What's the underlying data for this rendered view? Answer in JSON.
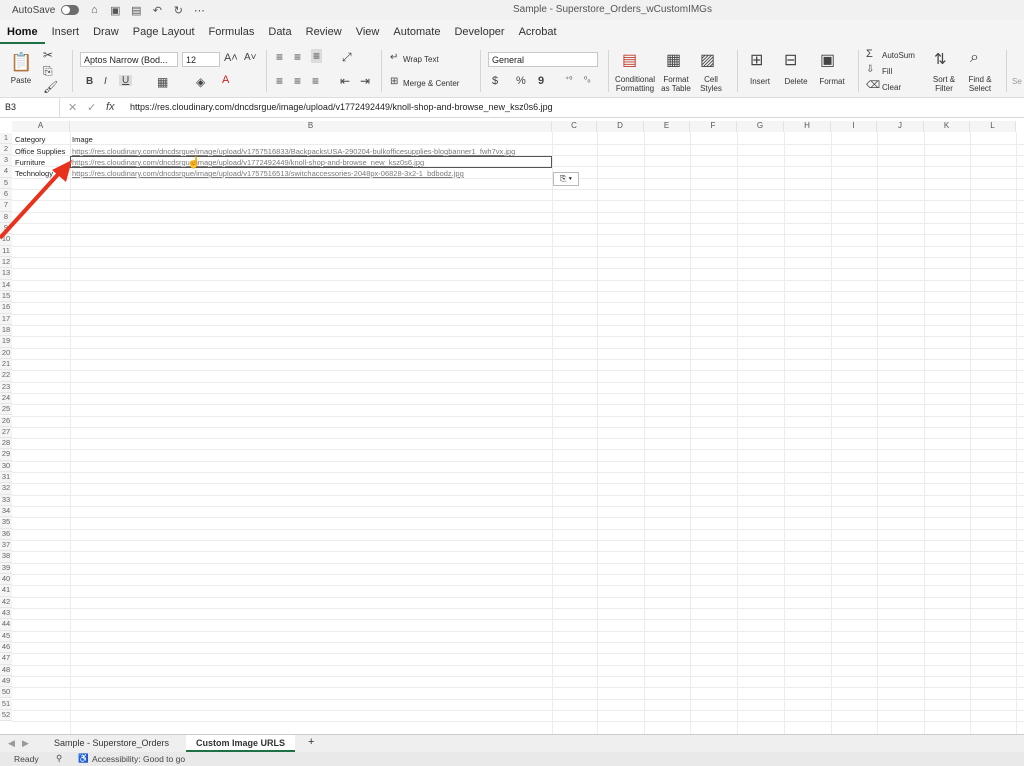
{
  "titlebar": {
    "autosave": "AutoSave",
    "title": "Sample - Superstore_Orders_wCustomIMGs"
  },
  "tabs": [
    "Home",
    "Insert",
    "Draw",
    "Page Layout",
    "Formulas",
    "Data",
    "Review",
    "View",
    "Automate",
    "Developer",
    "Acrobat"
  ],
  "ribbon": {
    "paste": "Paste",
    "font_name": "Aptos Narrow (Bod...",
    "font_size": "12",
    "bold": "B",
    "italic": "I",
    "underline": "U",
    "wrap_text": "Wrap Text",
    "merge_center": "Merge & Center",
    "number_format": "General",
    "currency": "$",
    "percent": "%",
    "comma": "9",
    "cond_fmt_1": "Conditional",
    "cond_fmt_2": "Formatting",
    "fmt_table_1": "Format",
    "fmt_table_2": "as Table",
    "cell_styles_1": "Cell",
    "cell_styles_2": "Styles",
    "insert": "Insert",
    "delete": "Delete",
    "format": "Format",
    "autosum": "AutoSum",
    "fill": "Fill",
    "clear": "Clear",
    "sort_1": "Sort &",
    "sort_2": "Filter",
    "find_1": "Find &",
    "find_2": "Select",
    "sens": "Se"
  },
  "formula_bar": {
    "name_box": "B3",
    "fx": "fx",
    "value": "https://res.cloudinary.com/dncdsrgue/image/upload/v1772492449/knoll-shop-and-browse_new_ksz0s6.jpg"
  },
  "columns": [
    "A",
    "B",
    "C",
    "D",
    "E",
    "F",
    "G",
    "H",
    "I",
    "J",
    "K",
    "L"
  ],
  "rows": [
    "1",
    "2",
    "3",
    "4",
    "5",
    "6",
    "7",
    "8",
    "9",
    "10",
    "11",
    "12",
    "13",
    "14",
    "15",
    "16",
    "17",
    "18",
    "19",
    "20",
    "21",
    "22",
    "23",
    "24",
    "25",
    "26",
    "27",
    "28",
    "29",
    "30",
    "31",
    "32",
    "33",
    "34",
    "35",
    "36",
    "37",
    "38",
    "39",
    "40",
    "41",
    "42",
    "43",
    "44",
    "45",
    "46",
    "47",
    "48",
    "49",
    "50",
    "51",
    "52"
  ],
  "cells": {
    "A1": "Category",
    "B1": "Image",
    "A2": "Office Supplies",
    "B2": "https://res.cloudinary.com/dncdsrgue/image/upload/v1757516833/BackpacksUSA-290204-bulkofficesupplies-blogbanner1_fwh7vx.jpg",
    "A3": "Furniture",
    "B3": "https://res.cloudinary.com/dncdsrgue/image/upload/v1772492449/knoll-shop-and-browse_new_ksz0s6.jpg",
    "A4": "Technology",
    "B4": "https://res.cloudinary.com/dncdsrgue/image/upload/v1757516513/switchaccessories-2048px-06828-3x2-1_bdbodz.jpg"
  },
  "sheet_tabs": [
    "Sample - Superstore_Orders",
    "Custom Image URLS"
  ],
  "add_sheet": "+",
  "status": {
    "ready": "Ready",
    "accessibility": "Accessibility: Good to go"
  },
  "colors": {
    "accent": "#1f7145",
    "annotation_arrow": "#e8321e"
  }
}
